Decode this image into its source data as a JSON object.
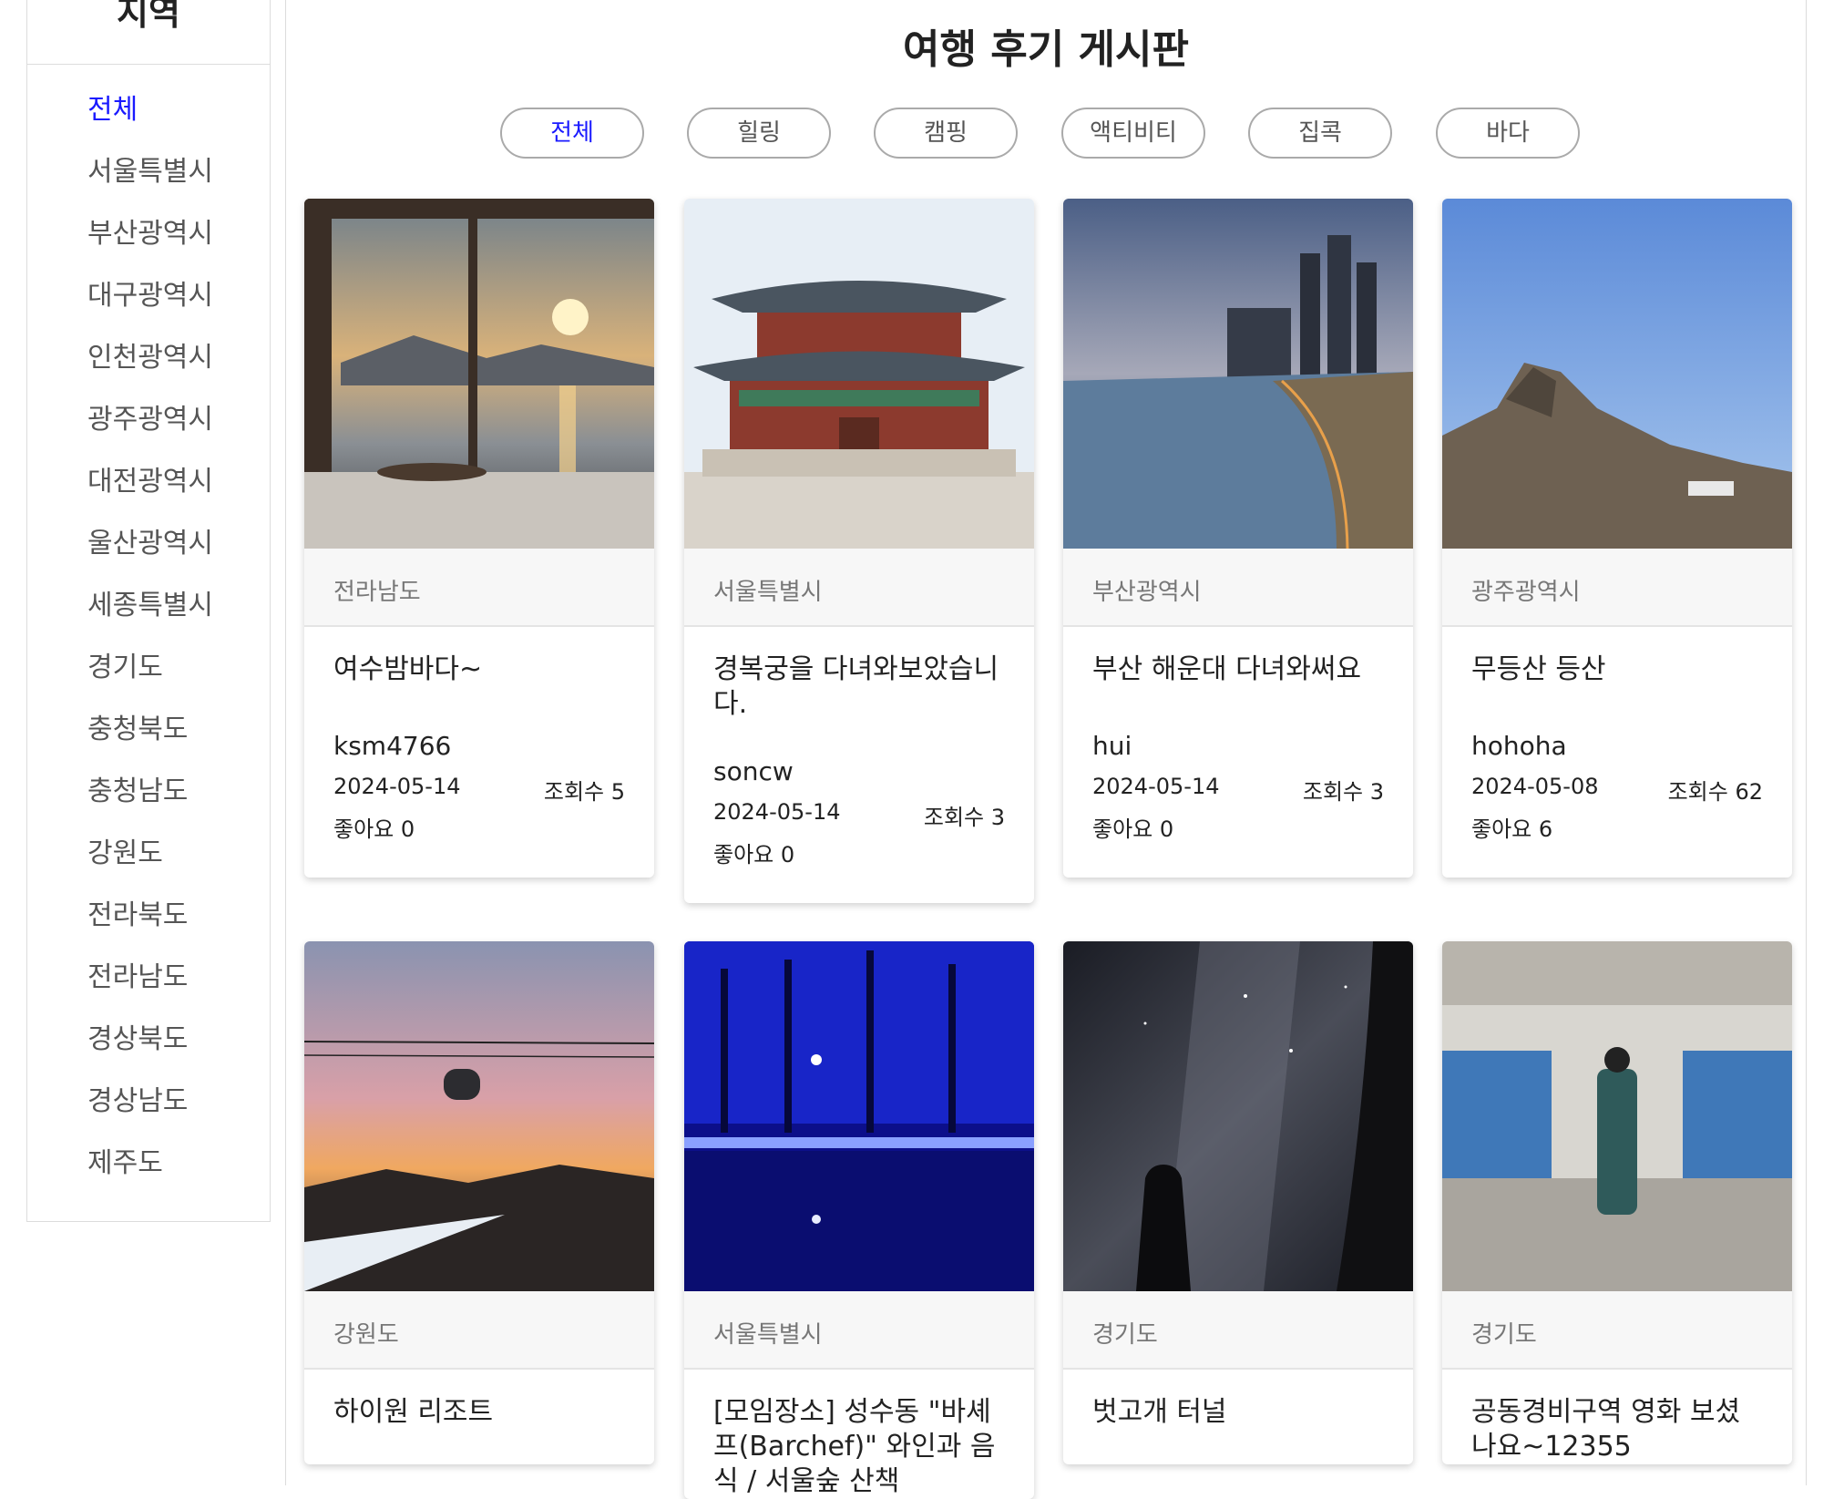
{
  "sidebar": {
    "title": "지역",
    "items": [
      "전체",
      "서울특별시",
      "부산광역시",
      "대구광역시",
      "인천광역시",
      "광주광역시",
      "대전광역시",
      "울산광역시",
      "세종특별시",
      "경기도",
      "충청북도",
      "충청남도",
      "강원도",
      "전라북도",
      "전라남도",
      "경상북도",
      "경상남도",
      "제주도"
    ],
    "active_index": 0
  },
  "page": {
    "title": "여행 후기 게시판"
  },
  "tags": [
    "전체",
    "힐링",
    "캠핑",
    "액티비티",
    "집콕",
    "바다"
  ],
  "colors": {
    "accent": "#1a1aff",
    "region_bg": "#f7f7f7"
  },
  "cards": [
    {
      "region": "전라남도",
      "title": "여수밤바다~",
      "author": "ksm4766",
      "date": "2024-05-14",
      "views": "조회수 5",
      "likes": "좋아요 0"
    },
    {
      "region": "서울특별시",
      "title": "경복궁을 다녀와보았습니다.",
      "author": "soncw",
      "date": "2024-05-14",
      "views": "조회수 3",
      "likes": "좋아요 0"
    },
    {
      "region": "부산광역시",
      "title": "부산 해운대 다녀와써요",
      "author": "hui",
      "date": "2024-05-14",
      "views": "조회수 3",
      "likes": "좋아요 0"
    },
    {
      "region": "광주광역시",
      "title": "무등산 등산",
      "author": "hohoha",
      "date": "2024-05-08",
      "views": "조회수 62",
      "likes": "좋아요 6"
    },
    {
      "region": "강원도",
      "title": "하이원 리조트"
    },
    {
      "region": "서울특별시",
      "title": "[모임장소] 성수동 \"바셰프(Barchef)\" 와인과 음식 / 서울숲 산책"
    },
    {
      "region": "경기도",
      "title": "벗고개 터널"
    },
    {
      "region": "경기도",
      "title": "공동경비구역 영화 보셨나요~12355"
    }
  ]
}
